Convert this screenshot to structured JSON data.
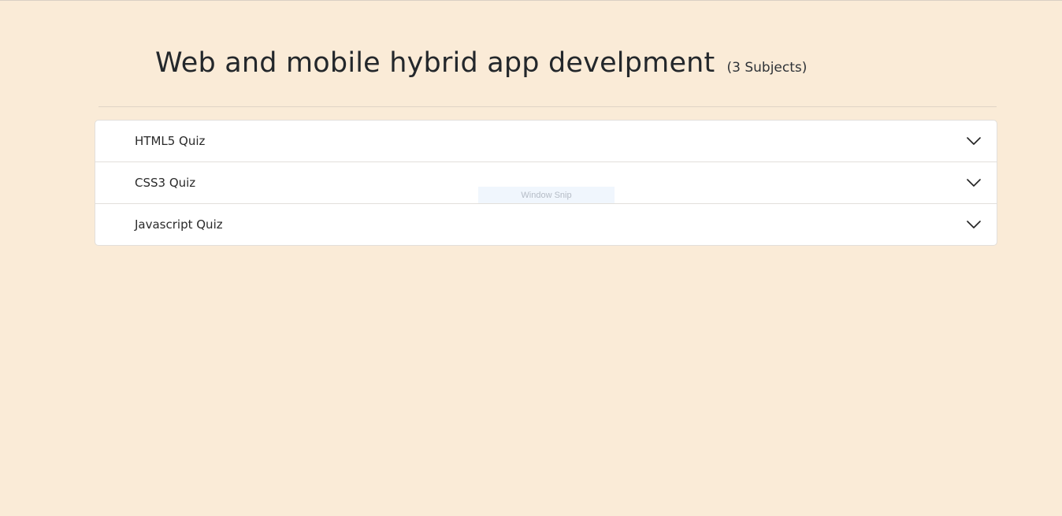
{
  "header": {
    "title": "Web and mobile hybrid app develpment",
    "count": "(3 Subjects)"
  },
  "quizzes": [
    {
      "label": "HTML5 Quiz",
      "icon": "chevron-down-icon"
    },
    {
      "label": "CSS3 Quiz",
      "icon": "chevron-down-icon"
    },
    {
      "label": "Javascript Quiz",
      "icon": "chevron-down-icon"
    }
  ],
  "overlay": {
    "label": "Window Snip"
  },
  "colors": {
    "background": "#faebd7",
    "card": "#ffffff",
    "text": "#23272b"
  }
}
